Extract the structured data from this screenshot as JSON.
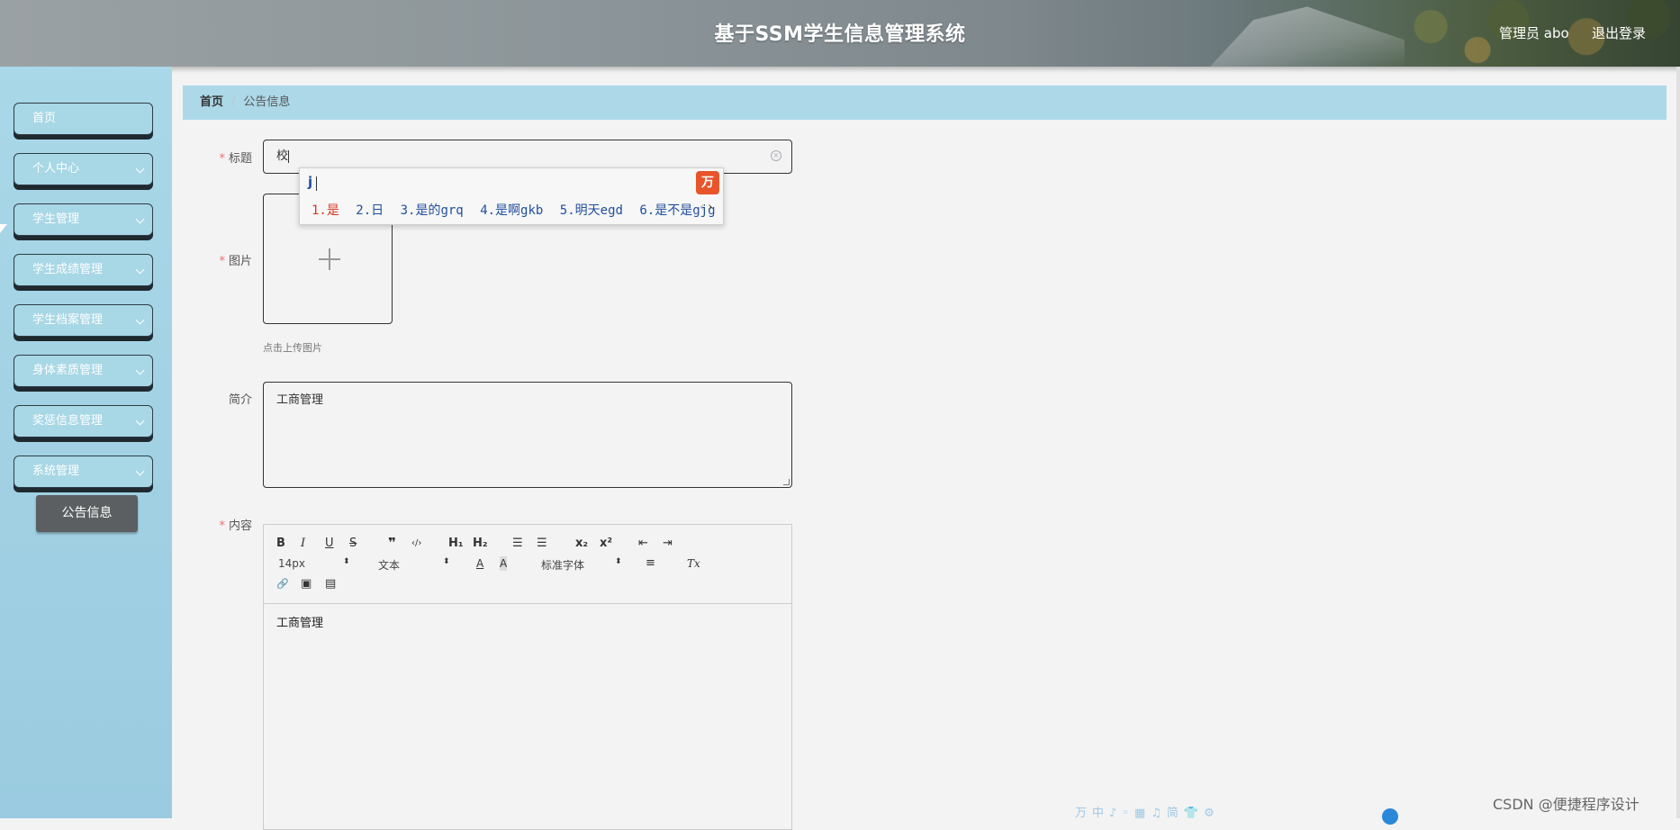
{
  "header": {
    "title": "基于SSM学生信息管理系统",
    "user": "管理员 abo",
    "logout": "退出登录"
  },
  "sidebar": {
    "items": [
      {
        "label": "首页",
        "expandable": false
      },
      {
        "label": "个人中心",
        "expandable": true
      },
      {
        "label": "学生管理",
        "expandable": true
      },
      {
        "label": "学生成绩管理",
        "expandable": true
      },
      {
        "label": "学生档案管理",
        "expandable": true
      },
      {
        "label": "身体素质管理",
        "expandable": true
      },
      {
        "label": "奖惩信息管理",
        "expandable": true
      },
      {
        "label": "系统管理",
        "expandable": true
      }
    ],
    "active_sub": "公告信息"
  },
  "breadcrumb": {
    "home": "首页",
    "separator": "/",
    "current": "公告信息"
  },
  "form": {
    "title": {
      "label": "标题",
      "value": "校",
      "required": true
    },
    "image": {
      "label": "图片",
      "required": true,
      "tip": "点击上传图片"
    },
    "intro": {
      "label": "简介",
      "value": "工商管理"
    },
    "content": {
      "label": "内容",
      "required": true,
      "value": "工商管理"
    }
  },
  "editor": {
    "toolbar": {
      "bold": "B",
      "italic": "I",
      "underline": "U",
      "strike": "S",
      "quote": "❞",
      "code": "‹/›",
      "h1": "H₁",
      "h2": "H₂",
      "ordered_list": "☰",
      "bullet_list": "☰",
      "sub": "x₂",
      "sup": "x²",
      "outdent": "⇤",
      "indent": "⇥",
      "font_size": "14px",
      "paragraph": "文本",
      "font_color": "A",
      "background": "A",
      "font_family": "标准字体",
      "align": "≡",
      "clean": "Tx",
      "link": "🔗",
      "image": "▣",
      "video": "▤"
    }
  },
  "ime": {
    "composition": "j",
    "logo": "万",
    "candidates": [
      "1.是",
      "2.日",
      "3.是的grq",
      "4.是啊gkb",
      "5.明天egd",
      "6.是不是gjg"
    ],
    "prev": "‹",
    "next": "›"
  },
  "ime_toolbar": "万中♪◦▦♫简👕⚙",
  "watermark": "CSDN @便捷程序设计"
}
